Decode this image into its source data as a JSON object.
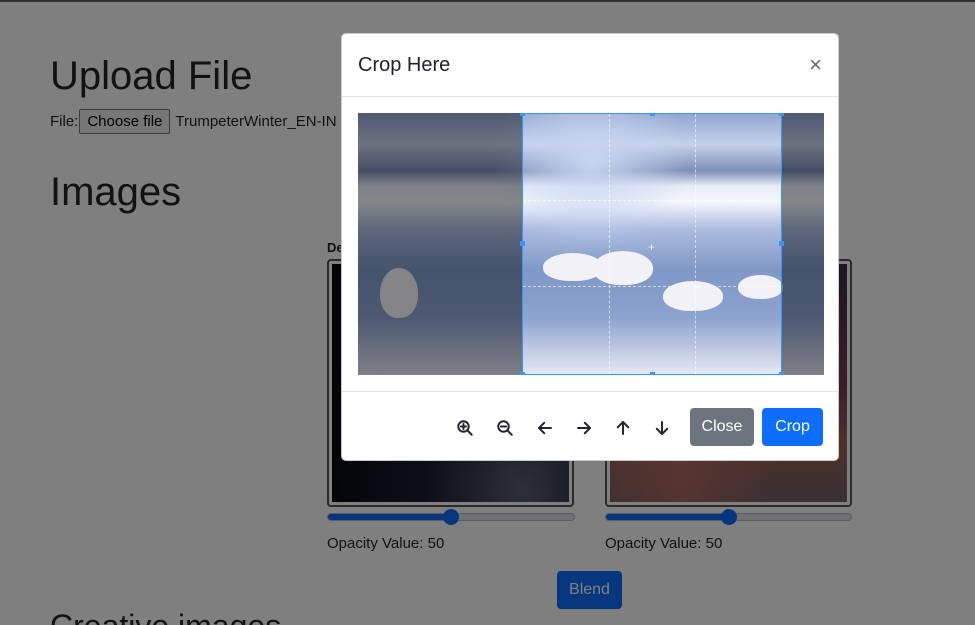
{
  "page": {
    "upload_heading": "Upload File",
    "file_label": "File:",
    "choose_file_label": "Choose file",
    "file_name": "TrumpeterWinter_EN-IN",
    "images_heading": "Images",
    "destination_label": "De",
    "opacity_a": "Opacity Value: 50",
    "opacity_b": "Opacity Value: 50",
    "opacity_a_value": 50,
    "opacity_b_value": 50,
    "blend_label": "Blend",
    "creative_heading": "Creative images"
  },
  "modal": {
    "title": "Crop Here",
    "close_symbol": "×",
    "toolbar": [
      {
        "name": "zoom-in-button",
        "icon": "zoom-in-icon"
      },
      {
        "name": "zoom-out-button",
        "icon": "zoom-out-icon"
      },
      {
        "name": "move-left-button",
        "icon": "arrow-left-icon"
      },
      {
        "name": "move-right-button",
        "icon": "arrow-right-icon"
      },
      {
        "name": "move-up-button",
        "icon": "arrow-up-icon"
      },
      {
        "name": "move-down-button",
        "icon": "arrow-down-icon"
      }
    ],
    "close_label": "Close",
    "crop_label": "Crop"
  },
  "colors": {
    "primary": "#0d6efd",
    "secondary": "#6c757d",
    "crop_border": "#3399ff"
  }
}
